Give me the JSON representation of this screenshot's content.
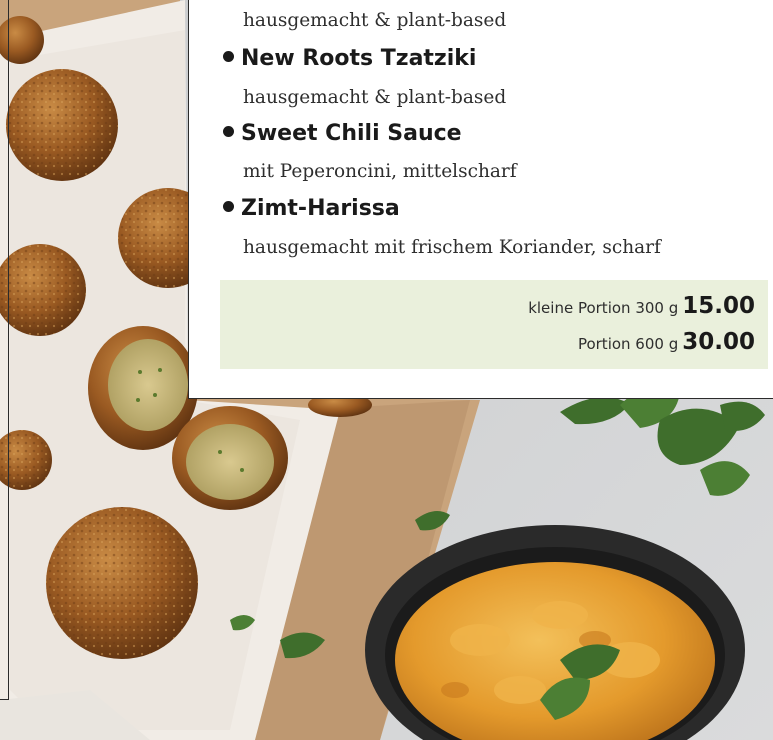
{
  "menu": {
    "items": [
      {
        "name": "",
        "description": "hausgemacht & plant-based"
      },
      {
        "name": "New Roots Tzatziki",
        "description": "hausgemacht & plant-based"
      },
      {
        "name": "Sweet Chili Sauce",
        "description": "mit Peperoncini, mittelscharf"
      },
      {
        "name": "Zimt-Harissa",
        "description": "hausgemacht mit frischem Koriander, scharf"
      }
    ],
    "prices": [
      {
        "label": "kleine Portion 300 g",
        "value": "15.00"
      },
      {
        "label": "Portion 600 g",
        "value": "30.00"
      }
    ]
  },
  "photo": {
    "subject": "falafel-balls-with-mango-chutney",
    "colors": {
      "table": "#cfd1d3",
      "board": "#c9a47c",
      "paper": "#f1ece6",
      "falafel": "#9a5a22",
      "chutney": "#e7a234",
      "bowl": "#2a2a2a",
      "herb": "#3f6e2c"
    }
  }
}
